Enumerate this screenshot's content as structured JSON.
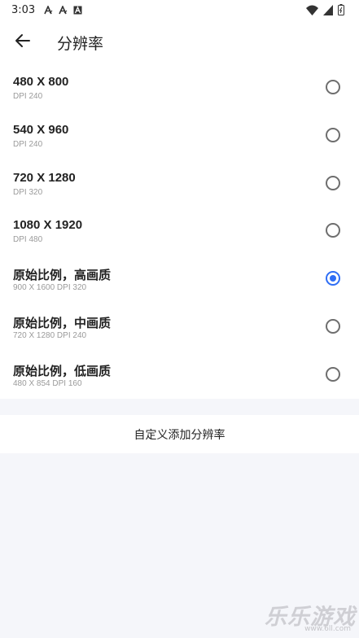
{
  "status_bar": {
    "time": "3:03",
    "notification_icons": [
      "font-a-icon",
      "font-a-icon",
      "font-a-box-icon"
    ],
    "system_icons": [
      "wifi-icon",
      "signal-icon",
      "battery-icon"
    ]
  },
  "app_bar": {
    "back_icon": "arrow-left-icon",
    "title": "分辨率"
  },
  "resolutions": [
    {
      "label": "480 X 800",
      "detail": "DPI 240",
      "selected": false
    },
    {
      "label": "540 X 960",
      "detail": "DPI 240",
      "selected": false
    },
    {
      "label": "720 X 1280",
      "detail": "DPI 320",
      "selected": false
    },
    {
      "label": "1080 X 1920",
      "detail": "DPI 480",
      "selected": false
    },
    {
      "label": "原始比例，高画质",
      "detail": "900 X 1600 DPI 320",
      "selected": true
    },
    {
      "label": "原始比例，中画质",
      "detail": "720 X 1280 DPI 240",
      "selected": false
    },
    {
      "label": "原始比例，低画质",
      "detail": "480 X 854 DPI 160",
      "selected": false
    }
  ],
  "custom_add": {
    "label": "自定义添加分辨率"
  },
  "watermark": {
    "title": "乐乐游戏",
    "url": "www.6ll.com"
  },
  "colors": {
    "accent": "#2f6ef5",
    "background": "#f5f6fa",
    "surface": "#ffffff"
  }
}
